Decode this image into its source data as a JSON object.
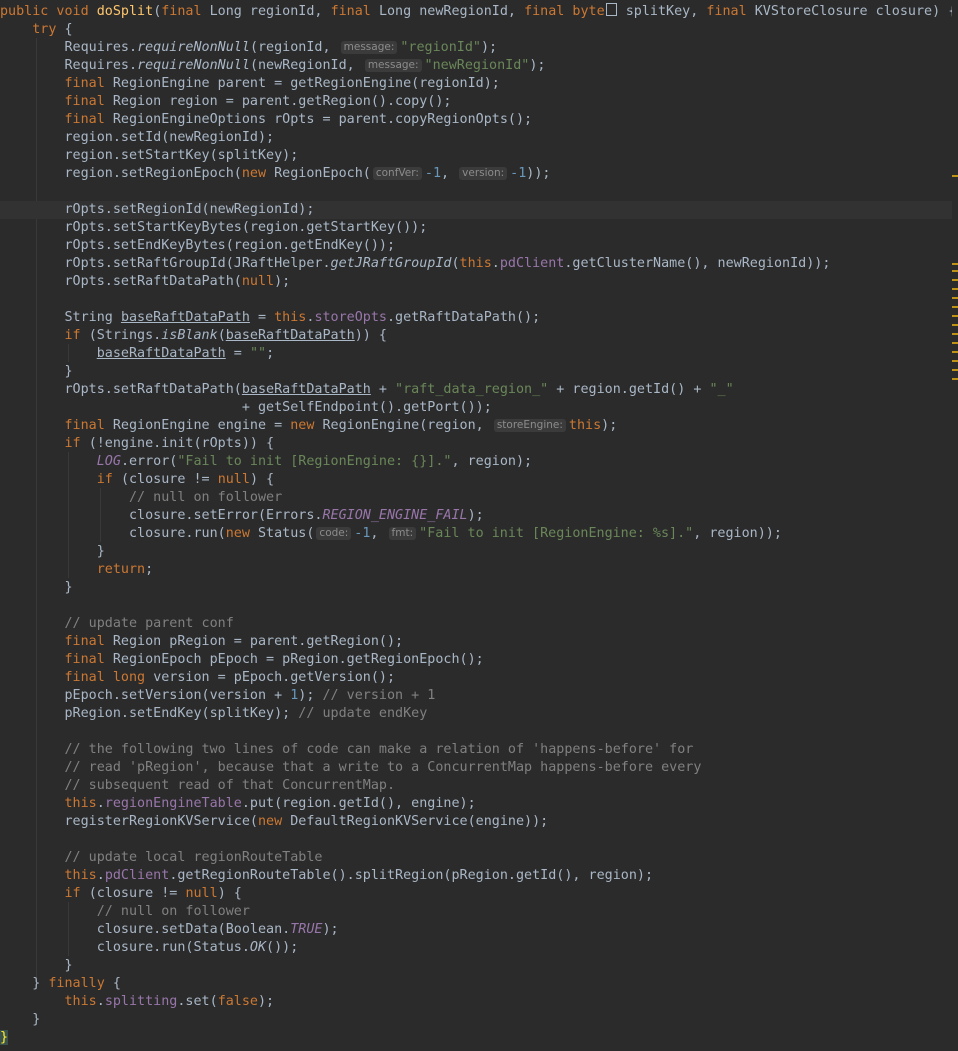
{
  "editor": {
    "language": "java",
    "text_color": "#a9b7c6",
    "background": "#2b2b2b",
    "lines": [
      "public void doSplit(final Long regionId, final Long newRegionId, final byte[] splitKey, final KVStoreClosure closure) {",
      "    try {",
      "        Requires.requireNonNull(regionId, message: \"regionId\");",
      "        Requires.requireNonNull(newRegionId, message: \"newRegionId\");",
      "        final RegionEngine parent = getRegionEngine(regionId);",
      "        final Region region = parent.getRegion().copy();",
      "        final RegionEngineOptions rOpts = parent.copyRegionOpts();",
      "        region.setId(newRegionId);",
      "        region.setStartKey(splitKey);",
      "        region.setRegionEpoch(new RegionEpoch( confVer: -1, version: -1));",
      "",
      "        rOpts.setRegionId(newRegionId);",
      "        rOpts.setStartKeyBytes(region.getStartKey());",
      "        rOpts.setEndKeyBytes(region.getEndKey());",
      "        rOpts.setRaftGroupId(JRaftHelper.getJRaftGroupId(this.pdClient.getClusterName(), newRegionId));",
      "        rOpts.setRaftDataPath(null);",
      "",
      "        String baseRaftDataPath = this.storeOpts.getRaftDataPath();",
      "        if (Strings.isBlank(baseRaftDataPath)) {",
      "            baseRaftDataPath = \"\";",
      "        }",
      "        rOpts.setRaftDataPath(baseRaftDataPath + \"raft_data_region_\" + region.getId() + \"_\"",
      "                              + getSelfEndpoint().getPort());",
      "        final RegionEngine engine = new RegionEngine(region, storeEngine: this);",
      "        if (!engine.init(rOpts)) {",
      "            LOG.error(\"Fail to init [RegionEngine: {}].\", region);",
      "            if (closure != null) {",
      "                // null on follower",
      "                closure.setError(Errors.REGION_ENGINE_FAIL);",
      "                closure.run(new Status( code: -1, fmt: \"Fail to init [RegionEngine: %s].\", region));",
      "            }",
      "            return;",
      "        }",
      "",
      "        // update parent conf",
      "        final Region pRegion = parent.getRegion();",
      "        final RegionEpoch pEpoch = pRegion.getRegionEpoch();",
      "        final long version = pEpoch.getVersion();",
      "        pEpoch.setVersion(version + 1); // version + 1",
      "        pRegion.setEndKey(splitKey); // update endKey",
      "",
      "        // the following two lines of code can make a relation of 'happens-before' for",
      "        // read 'pRegion', because that a write to a ConcurrentMap happens-before every",
      "        // subsequent read of that ConcurrentMap.",
      "        this.regionEngineTable.put(region.getId(), engine);",
      "        registerRegionKVService(new DefaultRegionKVService(engine));",
      "",
      "        // update local regionRouteTable",
      "        this.pdClient.getRegionRouteTable().splitRegion(pRegion.getId(), region);",
      "        if (closure != null) {",
      "            // null on follower",
      "            closure.setData(Boolean.TRUE);",
      "            closure.run(Status.OK());",
      "        }",
      "    } finally {",
      "        this.splitting.set(false);",
      "    }",
      "}"
    ]
  }
}
